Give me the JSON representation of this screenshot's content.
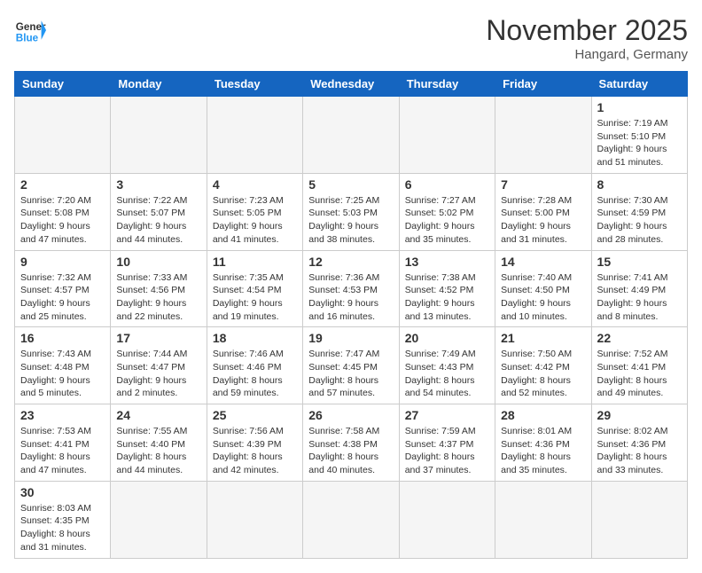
{
  "header": {
    "logo_general": "General",
    "logo_blue": "Blue",
    "month_year": "November 2025",
    "location": "Hangard, Germany"
  },
  "days_of_week": [
    "Sunday",
    "Monday",
    "Tuesday",
    "Wednesday",
    "Thursday",
    "Friday",
    "Saturday"
  ],
  "weeks": [
    [
      {
        "day": "",
        "info": ""
      },
      {
        "day": "",
        "info": ""
      },
      {
        "day": "",
        "info": ""
      },
      {
        "day": "",
        "info": ""
      },
      {
        "day": "",
        "info": ""
      },
      {
        "day": "",
        "info": ""
      },
      {
        "day": "1",
        "info": "Sunrise: 7:19 AM\nSunset: 5:10 PM\nDaylight: 9 hours and 51 minutes."
      }
    ],
    [
      {
        "day": "2",
        "info": "Sunrise: 7:20 AM\nSunset: 5:08 PM\nDaylight: 9 hours and 47 minutes."
      },
      {
        "day": "3",
        "info": "Sunrise: 7:22 AM\nSunset: 5:07 PM\nDaylight: 9 hours and 44 minutes."
      },
      {
        "day": "4",
        "info": "Sunrise: 7:23 AM\nSunset: 5:05 PM\nDaylight: 9 hours and 41 minutes."
      },
      {
        "day": "5",
        "info": "Sunrise: 7:25 AM\nSunset: 5:03 PM\nDaylight: 9 hours and 38 minutes."
      },
      {
        "day": "6",
        "info": "Sunrise: 7:27 AM\nSunset: 5:02 PM\nDaylight: 9 hours and 35 minutes."
      },
      {
        "day": "7",
        "info": "Sunrise: 7:28 AM\nSunset: 5:00 PM\nDaylight: 9 hours and 31 minutes."
      },
      {
        "day": "8",
        "info": "Sunrise: 7:30 AM\nSunset: 4:59 PM\nDaylight: 9 hours and 28 minutes."
      }
    ],
    [
      {
        "day": "9",
        "info": "Sunrise: 7:32 AM\nSunset: 4:57 PM\nDaylight: 9 hours and 25 minutes."
      },
      {
        "day": "10",
        "info": "Sunrise: 7:33 AM\nSunset: 4:56 PM\nDaylight: 9 hours and 22 minutes."
      },
      {
        "day": "11",
        "info": "Sunrise: 7:35 AM\nSunset: 4:54 PM\nDaylight: 9 hours and 19 minutes."
      },
      {
        "day": "12",
        "info": "Sunrise: 7:36 AM\nSunset: 4:53 PM\nDaylight: 9 hours and 16 minutes."
      },
      {
        "day": "13",
        "info": "Sunrise: 7:38 AM\nSunset: 4:52 PM\nDaylight: 9 hours and 13 minutes."
      },
      {
        "day": "14",
        "info": "Sunrise: 7:40 AM\nSunset: 4:50 PM\nDaylight: 9 hours and 10 minutes."
      },
      {
        "day": "15",
        "info": "Sunrise: 7:41 AM\nSunset: 4:49 PM\nDaylight: 9 hours and 8 minutes."
      }
    ],
    [
      {
        "day": "16",
        "info": "Sunrise: 7:43 AM\nSunset: 4:48 PM\nDaylight: 9 hours and 5 minutes."
      },
      {
        "day": "17",
        "info": "Sunrise: 7:44 AM\nSunset: 4:47 PM\nDaylight: 9 hours and 2 minutes."
      },
      {
        "day": "18",
        "info": "Sunrise: 7:46 AM\nSunset: 4:46 PM\nDaylight: 8 hours and 59 minutes."
      },
      {
        "day": "19",
        "info": "Sunrise: 7:47 AM\nSunset: 4:45 PM\nDaylight: 8 hours and 57 minutes."
      },
      {
        "day": "20",
        "info": "Sunrise: 7:49 AM\nSunset: 4:43 PM\nDaylight: 8 hours and 54 minutes."
      },
      {
        "day": "21",
        "info": "Sunrise: 7:50 AM\nSunset: 4:42 PM\nDaylight: 8 hours and 52 minutes."
      },
      {
        "day": "22",
        "info": "Sunrise: 7:52 AM\nSunset: 4:41 PM\nDaylight: 8 hours and 49 minutes."
      }
    ],
    [
      {
        "day": "23",
        "info": "Sunrise: 7:53 AM\nSunset: 4:41 PM\nDaylight: 8 hours and 47 minutes."
      },
      {
        "day": "24",
        "info": "Sunrise: 7:55 AM\nSunset: 4:40 PM\nDaylight: 8 hours and 44 minutes."
      },
      {
        "day": "25",
        "info": "Sunrise: 7:56 AM\nSunset: 4:39 PM\nDaylight: 8 hours and 42 minutes."
      },
      {
        "day": "26",
        "info": "Sunrise: 7:58 AM\nSunset: 4:38 PM\nDaylight: 8 hours and 40 minutes."
      },
      {
        "day": "27",
        "info": "Sunrise: 7:59 AM\nSunset: 4:37 PM\nDaylight: 8 hours and 37 minutes."
      },
      {
        "day": "28",
        "info": "Sunrise: 8:01 AM\nSunset: 4:36 PM\nDaylight: 8 hours and 35 minutes."
      },
      {
        "day": "29",
        "info": "Sunrise: 8:02 AM\nSunset: 4:36 PM\nDaylight: 8 hours and 33 minutes."
      }
    ],
    [
      {
        "day": "30",
        "info": "Sunrise: 8:03 AM\nSunset: 4:35 PM\nDaylight: 8 hours and 31 minutes."
      },
      {
        "day": "",
        "info": ""
      },
      {
        "day": "",
        "info": ""
      },
      {
        "day": "",
        "info": ""
      },
      {
        "day": "",
        "info": ""
      },
      {
        "day": "",
        "info": ""
      },
      {
        "day": "",
        "info": ""
      }
    ]
  ]
}
